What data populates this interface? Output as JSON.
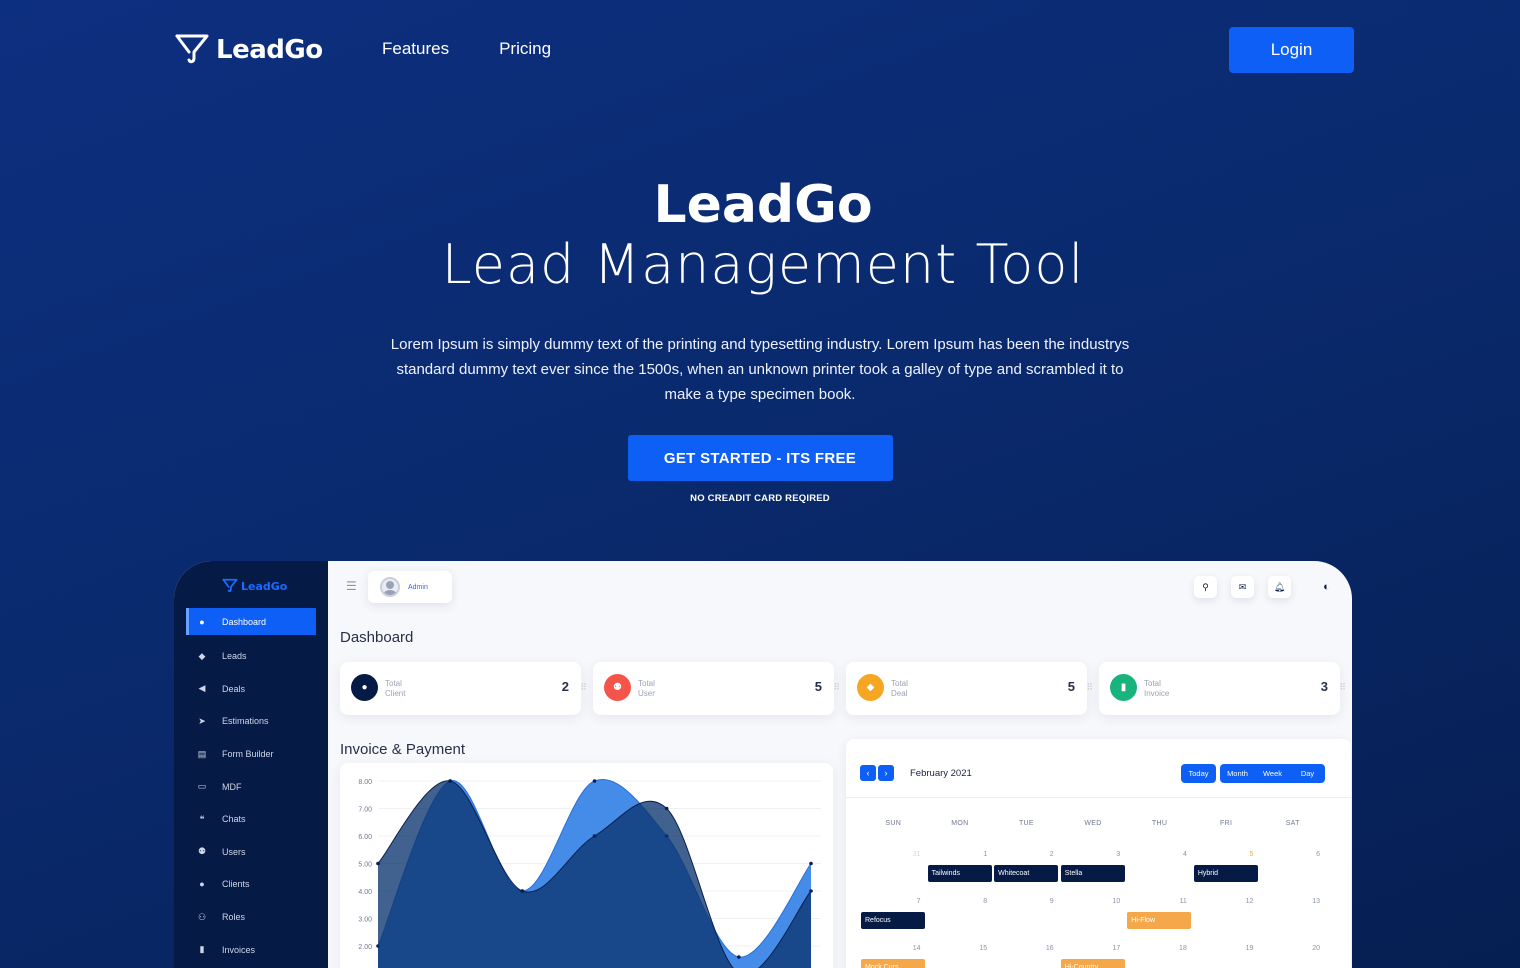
{
  "nav": {
    "brand": "LeadGo",
    "links": [
      "Features",
      "Pricing"
    ],
    "login": "Login"
  },
  "hero": {
    "title": "LeadGo",
    "subtitle": "Lead Management Tool",
    "description": "Lorem Ipsum is simply dummy text of the printing and typesetting industry. Lorem Ipsum has been the industrys standard dummy text ever since the 1500s, when an unknown printer took a galley of type and scrambled it to make a type specimen book.",
    "cta": "GET STARTED - ITS FREE",
    "cta_note": "NO CREADIT CARD REQIRED"
  },
  "app": {
    "brand": "LeadGo",
    "sidebar": [
      {
        "label": "Dashboard",
        "icon": "dashboard-icon",
        "glyph": "●"
      },
      {
        "label": "Leads",
        "icon": "leads-icon",
        "glyph": "◆"
      },
      {
        "label": "Deals",
        "icon": "deals-icon",
        "glyph": "◀"
      },
      {
        "label": "Estimations",
        "icon": "estimations-icon",
        "glyph": "➤"
      },
      {
        "label": "Form Builder",
        "icon": "form-builder-icon",
        "glyph": "▤"
      },
      {
        "label": "MDF",
        "icon": "mdf-icon",
        "glyph": "▭"
      },
      {
        "label": "Chats",
        "icon": "chats-icon",
        "glyph": "❝"
      },
      {
        "label": "Users",
        "icon": "users-icon",
        "glyph": "⚉"
      },
      {
        "label": "Clients",
        "icon": "clients-icon",
        "glyph": "●"
      },
      {
        "label": "Roles",
        "icon": "roles-icon",
        "glyph": "⚇"
      },
      {
        "label": "Invoices",
        "icon": "invoices-icon",
        "glyph": "▮"
      }
    ],
    "admin_label": "Admin",
    "page_title": "Dashboard",
    "stats": [
      {
        "line1": "Total",
        "line2": "Client",
        "value": "2",
        "color": "#061a46",
        "glyph": "●"
      },
      {
        "line1": "Total",
        "line2": "User",
        "value": "5",
        "color": "#f4544a",
        "glyph": "⚉"
      },
      {
        "line1": "Total",
        "line2": "Deal",
        "value": "5",
        "color": "#f5a623",
        "glyph": "◆"
      },
      {
        "line1": "Total",
        "line2": "Invoice",
        "value": "3",
        "color": "#19b37d",
        "glyph": "▮"
      }
    ],
    "chart_title": "Invoice & Payment",
    "calendar": {
      "month": "February 2021",
      "today": "Today",
      "views": [
        "Month",
        "Week",
        "Day"
      ],
      "days": [
        "SUN",
        "MON",
        "TUE",
        "WED",
        "THU",
        "FRI",
        "SAT"
      ],
      "weeks": [
        [
          "31",
          "1",
          "2",
          "3",
          "4",
          "5",
          "6"
        ],
        [
          "7",
          "8",
          "9",
          "10",
          "11",
          "12",
          "13"
        ],
        [
          "14",
          "15",
          "16",
          "17",
          "18",
          "19",
          "20"
        ]
      ],
      "events": [
        {
          "week": 0,
          "day": 1,
          "label": "Tailwinds",
          "kind": "dark"
        },
        {
          "week": 0,
          "day": 2,
          "label": "Whitecoat",
          "kind": "dark"
        },
        {
          "week": 0,
          "day": 3,
          "label": "Stella",
          "kind": "dark"
        },
        {
          "week": 0,
          "day": 5,
          "label": "Hybrid",
          "kind": "dark"
        },
        {
          "week": 1,
          "day": 0,
          "label": "Refocus",
          "kind": "dark"
        },
        {
          "week": 1,
          "day": 4,
          "label": "Hi-Flow",
          "kind": "orange"
        },
        {
          "week": 2,
          "day": 0,
          "label": "Mock Curs",
          "kind": "orange"
        },
        {
          "week": 2,
          "day": 3,
          "label": "Hi-Country",
          "kind": "orange"
        }
      ]
    }
  },
  "chart_data": {
    "type": "area",
    "title": "Invoice & Payment",
    "ylim": [
      2,
      8
    ],
    "yticks": [
      "8.00",
      "7.00",
      "6.00",
      "5.00",
      "4.00",
      "3.00",
      "2.00"
    ],
    "series": [
      {
        "values": [
          2.0,
          8.0,
          4.0,
          8.0,
          6.0,
          1.6,
          5.0
        ],
        "color": "#3b86e8"
      },
      {
        "values": [
          5.0,
          8.0,
          4.0,
          6.0,
          7.0,
          1.0,
          4.0
        ],
        "color": "#0c3470"
      }
    ]
  }
}
